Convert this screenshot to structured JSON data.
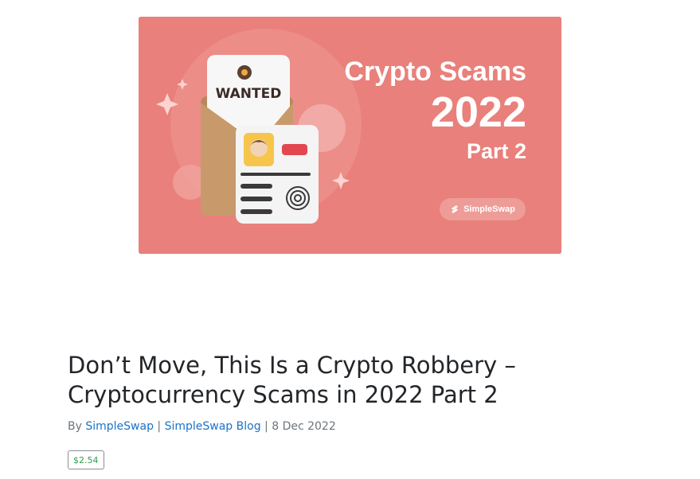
{
  "banner": {
    "wanted_text": "WANTED",
    "title_line1": "Crypto Scams",
    "title_line2": "2022",
    "title_line3": "Part 2",
    "brand": "SimpleSwap",
    "background_color": "#e9807b"
  },
  "article": {
    "title": "Don’t Move, This Is a Crypto Robbery – Cryptocurrency Scams in 2022 Part 2",
    "byline_prefix": "By",
    "author": "SimpleSwap",
    "separator": "|",
    "community": "SimpleSwap Blog",
    "date": "8 Dec 2022",
    "payout": "$2.54"
  },
  "colors": {
    "link": "#1a73c8",
    "payout": "#2e9f4a",
    "text": "#222529",
    "muted": "#6c757d"
  }
}
